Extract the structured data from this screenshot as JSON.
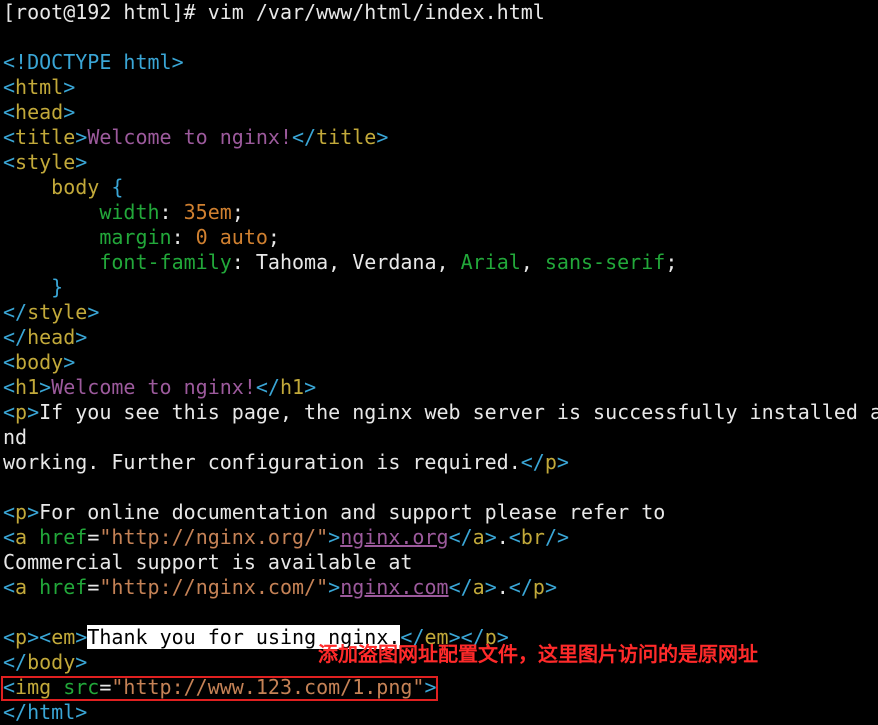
{
  "prompt": "[root@192 html]# vim /var/www/html/index.html",
  "code": {
    "doctype_open": "<!",
    "doctype_name": "DOCTYPE",
    "doctype_rest": " html",
    "gt": ">",
    "lt": "<",
    "lt_slash": "</",
    "html": "html",
    "head": "head",
    "title": "title",
    "title_text": "Welcome to nginx!",
    "style": "style",
    "body_selector": "    body ",
    "brace_open": "{",
    "brace_close": "    }",
    "indent2": "        ",
    "width_prop": "width",
    "width_val": "35em",
    "margin_prop": "margin",
    "margin_val": "0 auto",
    "font_prop": "font-family",
    "font_val_plain": "Tahoma, Verdana, ",
    "font_val_arial": "Arial",
    "font_val_sans": "sans-serif",
    "colon_space": ": ",
    "semicolon": ";",
    "comma_space": ", ",
    "body": "body",
    "h1": "h1",
    "h1_text": "Welcome to nginx!",
    "p": "p",
    "p1_text": "If you see this page, the nginx web server is successfully installed a",
    "p1_wrap": "nd",
    "p1_line2": "working. Further configuration is required.",
    "p2_text": "For online documentation and support please refer to",
    "a": "a",
    "href": "href",
    "eq": "=",
    "href_org": "\"http://nginx.org/\"",
    "link_org": "nginx.org",
    "dot": ".",
    "br": "br",
    "slash_gt": "/>",
    "commercial_text": "Commercial support is available at",
    "href_com": "\"http://nginx.com/\"",
    "link_com": "nginx.com",
    "em": "em",
    "thank_text": "Thank you for using nginx.",
    "img": "img",
    "src": "src",
    "img_src": "\"http://www.123.com/1.png\"",
    "space": " ",
    "html_close_partial": "</html>"
  },
  "annotation": {
    "text": "添加盗图网址配置文件，这里图片访问的是原网址",
    "color": "#ff2a2a"
  }
}
